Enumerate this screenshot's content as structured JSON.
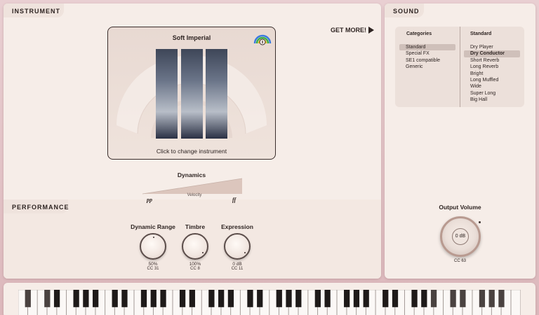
{
  "instrument": {
    "tab_label": "INSTRUMENT",
    "get_more_label": "GET MORE!",
    "name": "Soft Imperial",
    "change_hint": "Click to change instrument",
    "dynamics": {
      "label": "Dynamics",
      "pp": "pp",
      "velocity": "Velocity",
      "ff": "ff"
    }
  },
  "performance": {
    "tab_label": "PERFORMANCE",
    "knobs": [
      {
        "title": "Dynamic Range",
        "value": "50%",
        "cc": "CC 31"
      },
      {
        "title": "Timbre",
        "value": "100%",
        "cc": "CC 8"
      },
      {
        "title": "Expression",
        "value": "0 dB",
        "cc": "CC 11"
      }
    ]
  },
  "sound": {
    "tab_label": "SOUND",
    "categories_header": "Categories",
    "presets_header": "Standard",
    "categories": [
      "Standard",
      "Special FX",
      "SE1 compatible",
      "Generic"
    ],
    "selected_category": "Standard",
    "presets": [
      "Dry Player",
      "Dry Conductor",
      "Short Reverb",
      "Long Reverb",
      "Bright",
      "Long Muffled",
      "Wide",
      "Super Long",
      "Big Hall"
    ],
    "selected_preset": "Dry Conductor",
    "output": {
      "label": "Output Volume",
      "value": "0 dB",
      "cc": "CC 63"
    }
  },
  "colors": {
    "background": "#e9cfd2",
    "panel": "#f6ede8",
    "text": "#2e2422",
    "accent_ring": "#b89a90"
  },
  "keyboard": {
    "white_key_count": 52
  }
}
